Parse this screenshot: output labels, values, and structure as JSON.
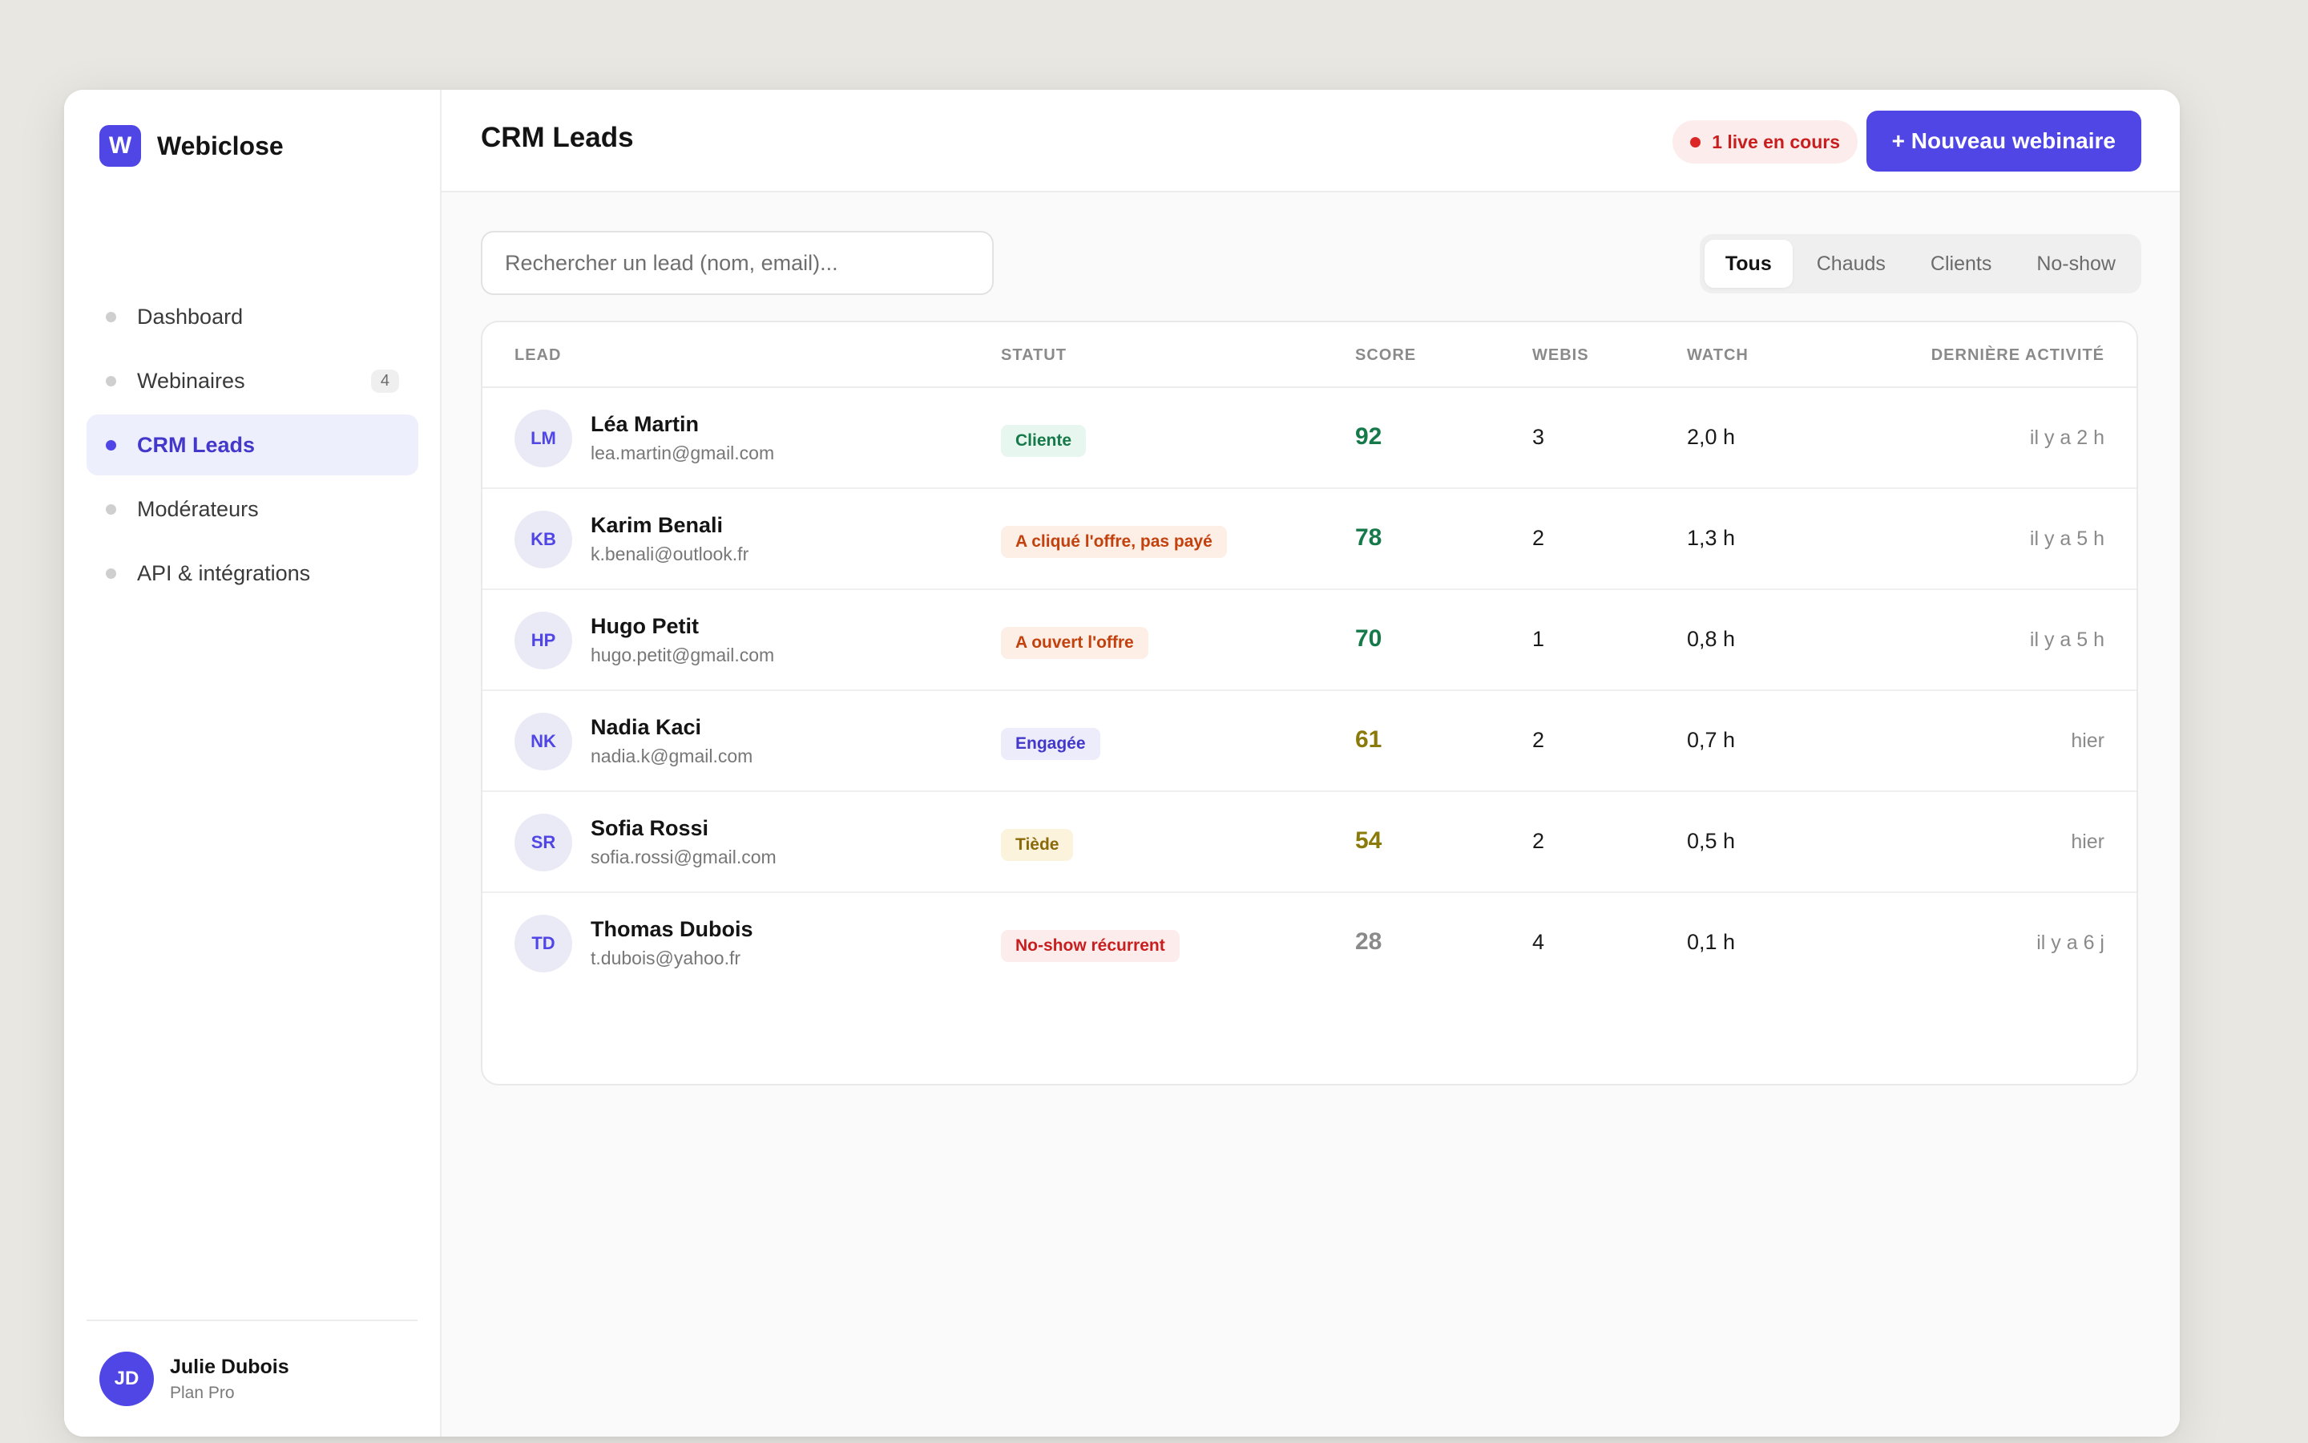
{
  "brand": {
    "logo_letter": "W",
    "name": "Webiclose"
  },
  "sidebar": {
    "items": [
      {
        "label": "Dashboard",
        "badge": ""
      },
      {
        "label": "Webinaires",
        "badge": "4"
      },
      {
        "label": "CRM Leads",
        "badge": ""
      },
      {
        "label": "Modérateurs",
        "badge": ""
      },
      {
        "label": "API & intégrations",
        "badge": ""
      }
    ],
    "user": {
      "initials": "JD",
      "name": "Julie Dubois",
      "plan": "Plan Pro"
    }
  },
  "header": {
    "title": "CRM Leads",
    "live_status": "1 live en cours",
    "new_button": "+ Nouveau webinaire"
  },
  "search": {
    "placeholder": "Rechercher un lead (nom, email)..."
  },
  "filters": [
    "Tous",
    "Chauds",
    "Clients",
    "No-show"
  ],
  "table": {
    "columns": [
      "LEAD",
      "STATUT",
      "SCORE",
      "WEBIS",
      "WATCH",
      "DERNIÈRE ACTIVITÉ"
    ],
    "rows": [
      {
        "initials": "LM",
        "name": "Léa Martin",
        "email": "lea.martin@gmail.com",
        "status": "Cliente",
        "status_color": "#16794a",
        "score": "92",
        "score_color": "#16794a",
        "webis": "3",
        "watch": "2,0 h",
        "last": "il y a 2 h"
      },
      {
        "initials": "KB",
        "name": "Karim Benali",
        "email": "k.benali@outlook.fr",
        "status": "A cliqué l'offre, pas payé",
        "status_color": "#c2410c",
        "score": "78",
        "score_color": "#16794a",
        "webis": "2",
        "watch": "1,3 h",
        "last": "il y a 5 h"
      },
      {
        "initials": "HP",
        "name": "Hugo Petit",
        "email": "hugo.petit@gmail.com",
        "status": "A ouvert l'offre",
        "status_color": "#c2410c",
        "score": "70",
        "score_color": "#16794a",
        "webis": "1",
        "watch": "0,8 h",
        "last": "il y a 5 h"
      },
      {
        "initials": "NK",
        "name": "Nadia Kaci",
        "email": "nadia.k@gmail.com",
        "status": "Engagée",
        "status_color": "#4338ca",
        "score": "61",
        "score_color": "#8a7a0a",
        "webis": "2",
        "watch": "0,7 h",
        "last": "hier"
      },
      {
        "initials": "SR",
        "name": "Sofia Rossi",
        "email": "sofia.rossi@gmail.com",
        "status": "Tiède",
        "status_color": "#8a6a0a",
        "score": "54",
        "score_color": "#8a7a0a",
        "webis": "2",
        "watch": "0,5 h",
        "last": "hier"
      },
      {
        "initials": "TD",
        "name": "Thomas Dubois",
        "email": "t.dubois@yahoo.fr",
        "status": "No-show récurrent",
        "status_color": "#c81e1e",
        "score": "28",
        "score_color": "#8a8a8a",
        "webis": "4",
        "watch": "0,1 h",
        "last": "il y a 6 j"
      }
    ]
  },
  "colors": {
    "accent": "#4f46e5",
    "live": "#dc2626",
    "background": "#e8e7e1"
  }
}
